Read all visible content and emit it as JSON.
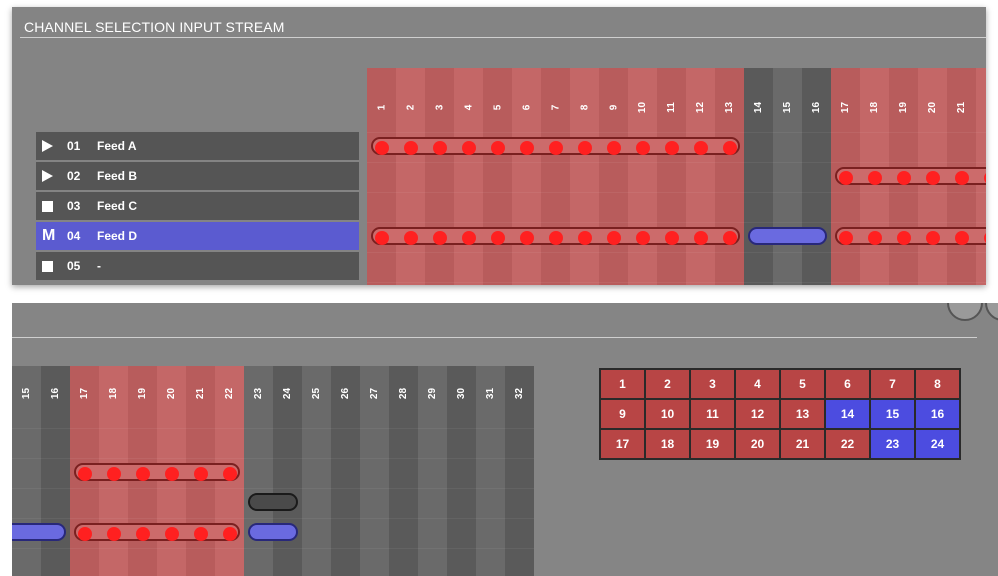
{
  "header": {
    "title": "CHANNEL SELECTION INPUT STREAM"
  },
  "channels": [
    {
      "number": "01",
      "name": "Feed A",
      "indicator": "play",
      "selected": false
    },
    {
      "number": "02",
      "name": "Feed B",
      "indicator": "play",
      "selected": false
    },
    {
      "number": "03",
      "name": "Feed C",
      "indicator": "square",
      "selected": false
    },
    {
      "number": "04",
      "name": "Feed D",
      "indicator": "M",
      "selected": true
    },
    {
      "number": "05",
      "name": "-",
      "indicator": "square",
      "selected": false
    }
  ],
  "panel1": {
    "columns": [
      "1",
      "2",
      "3",
      "4",
      "5",
      "6",
      "7",
      "8",
      "9",
      "10",
      "11",
      "12",
      "13",
      "14",
      "15",
      "16",
      "17",
      "18",
      "19",
      "20",
      "21",
      "22"
    ],
    "red_columns": [
      1,
      2,
      3,
      4,
      5,
      6,
      7,
      8,
      9,
      10,
      11,
      12,
      13,
      17,
      18,
      19,
      20,
      21,
      22
    ]
  },
  "panel2": {
    "columns": [
      "15",
      "16",
      "17",
      "18",
      "19",
      "20",
      "21",
      "22",
      "23",
      "24",
      "25",
      "26",
      "27",
      "28",
      "29",
      "30",
      "31",
      "32"
    ],
    "red_columns": [
      17,
      18,
      19,
      20,
      21,
      22
    ]
  },
  "assignments": [
    {
      "row": 1,
      "start": 1,
      "end": 13,
      "color": "red"
    },
    {
      "row": 2,
      "start": 17,
      "end": 22,
      "color": "red"
    },
    {
      "row": 3,
      "start": 23,
      "end": 24,
      "color": "dark"
    },
    {
      "row": 4,
      "start": 1,
      "end": 13,
      "color": "red"
    },
    {
      "row": 4,
      "start": 14,
      "end": 16,
      "color": "blue"
    },
    {
      "row": 4,
      "start": 17,
      "end": 22,
      "color": "red"
    },
    {
      "row": 4,
      "start": 23,
      "end": 24,
      "color": "blue"
    }
  ],
  "grid": {
    "rows": [
      [
        {
          "v": "1",
          "c": "r"
        },
        {
          "v": "2",
          "c": "r"
        },
        {
          "v": "3",
          "c": "r"
        },
        {
          "v": "4",
          "c": "r"
        },
        {
          "v": "5",
          "c": "r"
        },
        {
          "v": "6",
          "c": "r"
        },
        {
          "v": "7",
          "c": "r"
        },
        {
          "v": "8",
          "c": "r"
        }
      ],
      [
        {
          "v": "9",
          "c": "r"
        },
        {
          "v": "10",
          "c": "r"
        },
        {
          "v": "11",
          "c": "r"
        },
        {
          "v": "12",
          "c": "r"
        },
        {
          "v": "13",
          "c": "r"
        },
        {
          "v": "14",
          "c": "b"
        },
        {
          "v": "15",
          "c": "b"
        },
        {
          "v": "16",
          "c": "b"
        }
      ],
      [
        {
          "v": "17",
          "c": "r"
        },
        {
          "v": "18",
          "c": "r"
        },
        {
          "v": "19",
          "c": "r"
        },
        {
          "v": "20",
          "c": "r"
        },
        {
          "v": "21",
          "c": "r"
        },
        {
          "v": "22",
          "c": "r"
        },
        {
          "v": "23",
          "c": "b"
        },
        {
          "v": "24",
          "c": "b"
        }
      ]
    ]
  },
  "colors": {
    "red": "#b85c5c",
    "blue": "#5b5bd0",
    "gray": "#848484",
    "dot": "#ff2020"
  }
}
